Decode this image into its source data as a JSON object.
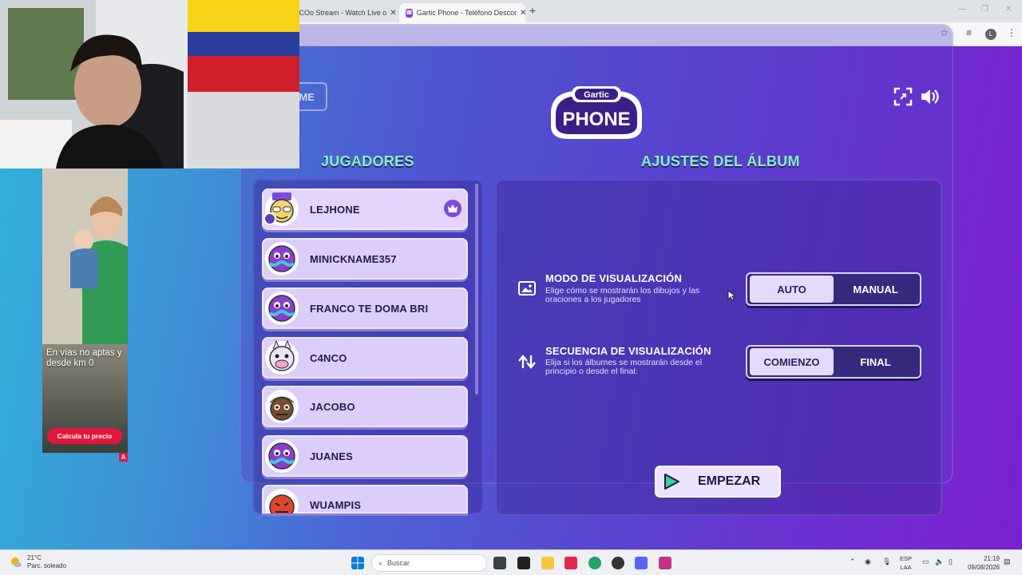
{
  "browser": {
    "tabs": [
      {
        "title": "NCOo Stream - Watch Live o",
        "active": false
      },
      {
        "title": "Gartic Phone - Teléfono Descor",
        "active": true
      }
    ],
    "new_tab": "+",
    "close_glyph": "✕",
    "profile_initial": "L"
  },
  "game": {
    "home_button": "ME",
    "logo_top": "Gartic",
    "logo_main": "PHONE",
    "players_heading": "JUGADORES",
    "settings_heading": "AJUSTES DEL ÁLBUM",
    "players": [
      {
        "name": "LEJHONE",
        "host": true
      },
      {
        "name": "MINICKNAME357"
      },
      {
        "name": "FRANCO TE DOMA BRI"
      },
      {
        "name": "C4NCO"
      },
      {
        "name": "JACOBO"
      },
      {
        "name": "JUANES"
      },
      {
        "name": "WUAMPIS"
      }
    ],
    "settings": [
      {
        "title": "MODO DE VISUALIZACIÓN",
        "description": "Elige cómo se mostrarán los dibujos y las oraciones a los jugadores",
        "options": [
          "AUTO",
          "MANUAL"
        ],
        "selected": "AUTO"
      },
      {
        "title": "SECUENCIA DE VISUALIZACIÓN",
        "description": "Elija si los álbumes se mostrarán desde el principio o desde el final:",
        "options": [
          "COMIENZO",
          "FINAL"
        ],
        "selected": "COMIENZO"
      }
    ],
    "start_button": "EMPEZAR"
  },
  "ad": {
    "text": "En vías no aptas y desde km 0",
    "cta": "Calcula tu precio",
    "badge": "A"
  },
  "taskbar": {
    "weather_temp": "21°C",
    "weather_desc": "Parc. soleado",
    "search_placeholder": "Buscar",
    "lang_top": "ESP",
    "lang_bottom": "LAA",
    "time": "21:19",
    "date": "09/08/2026"
  },
  "colors": {
    "heading": "#83f2bd",
    "player_card": "#dccdfa",
    "accent_purple": "#7d4bd8",
    "ad_red": "#e3173e"
  }
}
